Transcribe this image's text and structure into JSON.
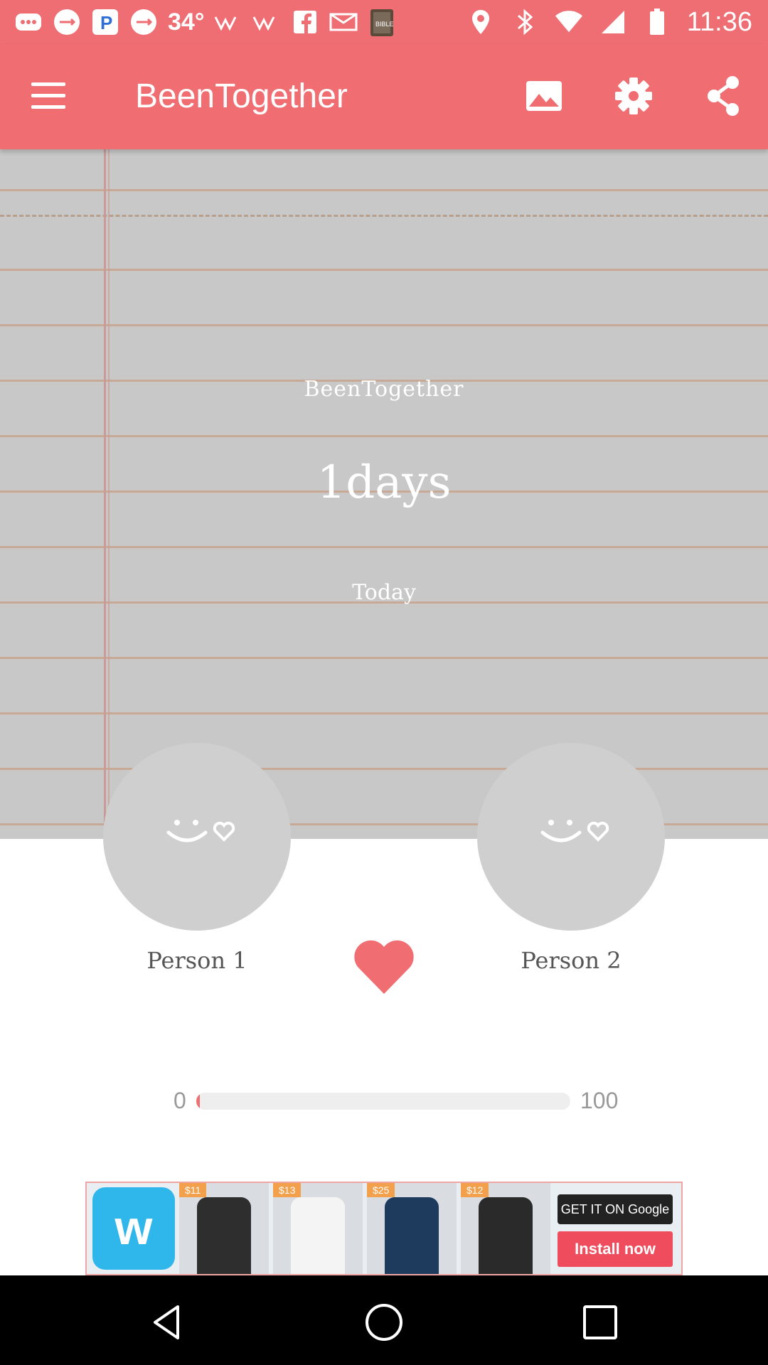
{
  "status_bar": {
    "temperature": "34°",
    "time": "11:36",
    "icons": [
      "more-icon",
      "usb-icon",
      "picsart-icon",
      "usb-icon",
      "weather-icon",
      "weather-icon",
      "facebook-icon",
      "gmail-icon",
      "bible-icon",
      "location-icon",
      "bluetooth-icon",
      "wifi-icon",
      "signal-icon",
      "battery-icon"
    ]
  },
  "app_bar": {
    "title": "BeenTogether",
    "actions": [
      "image-icon",
      "settings-icon",
      "share-icon"
    ]
  },
  "paper": {
    "title": "BeenTogether",
    "days": "1days",
    "date_label": "Today"
  },
  "people": {
    "person1": "Person 1",
    "person2": "Person 2"
  },
  "progress": {
    "min": "0",
    "max": "100",
    "value": 1
  },
  "ad": {
    "brand_logo": "w",
    "price_tags": [
      "$11",
      "$13",
      "$25",
      "$12"
    ],
    "store_badge": "GET IT ON Google Play",
    "install_label": "Install now"
  },
  "colors": {
    "primary": "#f06e72",
    "paper": "#c8c8c8",
    "heart": "#f06e72"
  }
}
